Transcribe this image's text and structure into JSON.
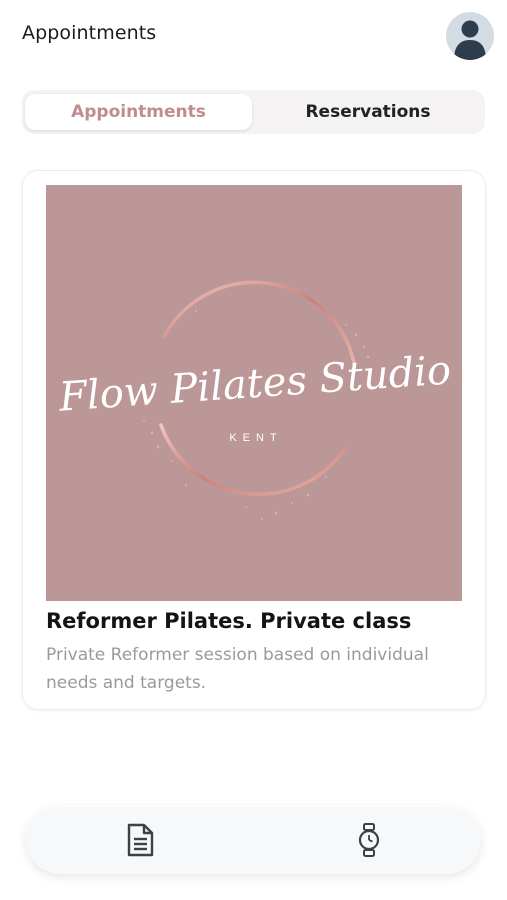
{
  "header": {
    "title": "Appointments",
    "avatar_icon": "user-avatar-icon"
  },
  "tabs": [
    {
      "label": "Appointments",
      "active": true
    },
    {
      "label": "Reservations",
      "active": false
    }
  ],
  "card": {
    "logo": {
      "script_text": "Flow Pilates Studio",
      "subtext": "KENT"
    },
    "title": "Reformer Pilates. Private class",
    "description": "Private Reformer session based on individual needs and targets."
  },
  "bottom_nav": [
    {
      "icon": "document-icon"
    },
    {
      "icon": "watch-icon"
    }
  ],
  "colors": {
    "accent": "#c08c8f",
    "image_bg": "#bb9897",
    "ring": "#d9a59f"
  }
}
